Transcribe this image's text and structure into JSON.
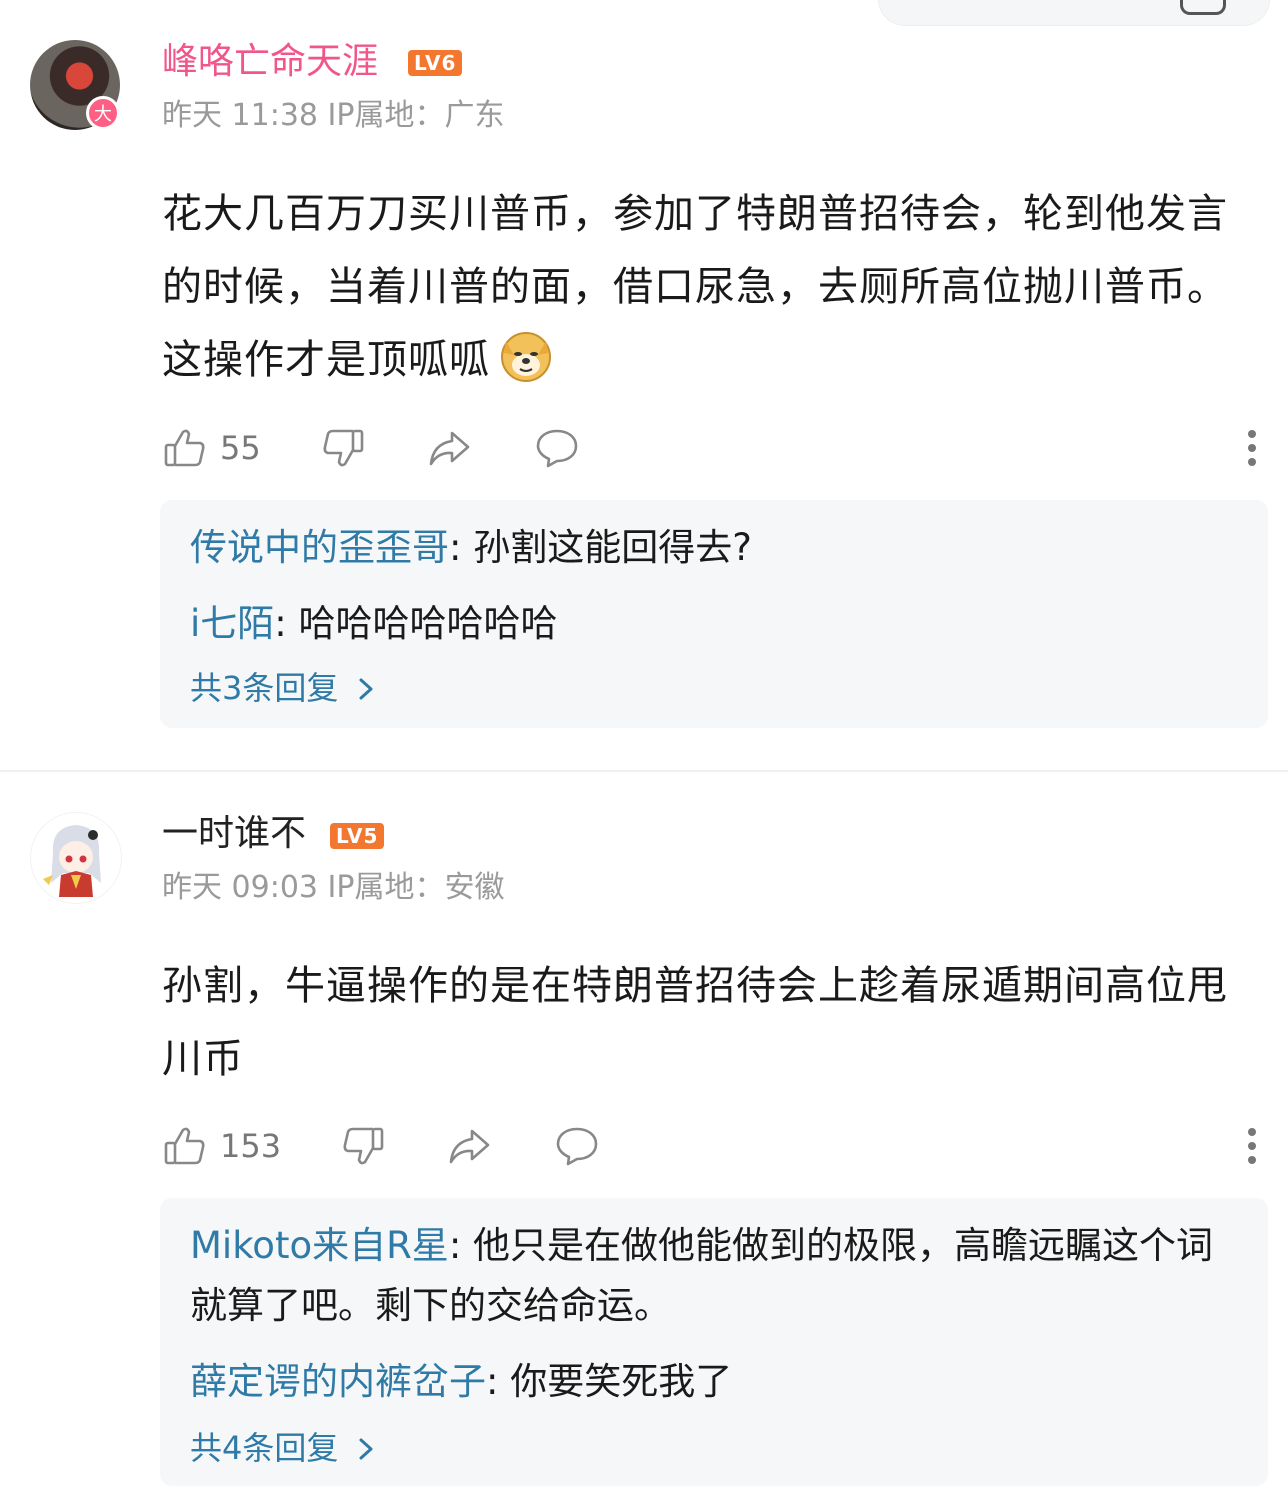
{
  "header": {
    "cut_text": ""
  },
  "comments": [
    {
      "username": "峰咯亡命天涯",
      "level": "LV6",
      "avatar_badge": "大",
      "time": "昨天 11:38",
      "ip_label": "IP属地：广东",
      "text": "花大几百万刀买川普币，参加了特朗普招待会，轮到他发言的时候，当着川普的面，借口尿急，去厕所高位抛川普币。这操作才是顶呱呱",
      "emoji": "doge-icon",
      "likes": "55",
      "replies": [
        {
          "name": "传说中的歪歪哥",
          "sep": ": ",
          "text": "孙割这能回得去?"
        },
        {
          "name": "i七陌",
          "sep": ": ",
          "text": "哈哈哈哈哈哈哈"
        }
      ],
      "more_replies": "共3条回复"
    },
    {
      "username": "一时谁不",
      "level": "LV5",
      "time": "昨天 09:03",
      "ip_label": "IP属地：安徽",
      "text": "孙割，牛逼操作的是在特朗普招待会上趁着尿遁期间高位甩川币",
      "likes": "153",
      "replies": [
        {
          "name": "Mikoto来自R星",
          "sep": ": ",
          "text": "他只是在做他能做到的极限，高瞻远瞩这个词就算了吧。剩下的交给命运。"
        },
        {
          "name": "薛定谔的内裤岔子",
          "sep": ": ",
          "text": "你要笑死我了"
        }
      ],
      "more_replies": "共4条回复"
    }
  ],
  "colors": {
    "username_vip": "#f0568a",
    "level_badge": "#f3772f",
    "reply_name": "#2f7aa6",
    "reply_bg": "#f6f7f8"
  }
}
